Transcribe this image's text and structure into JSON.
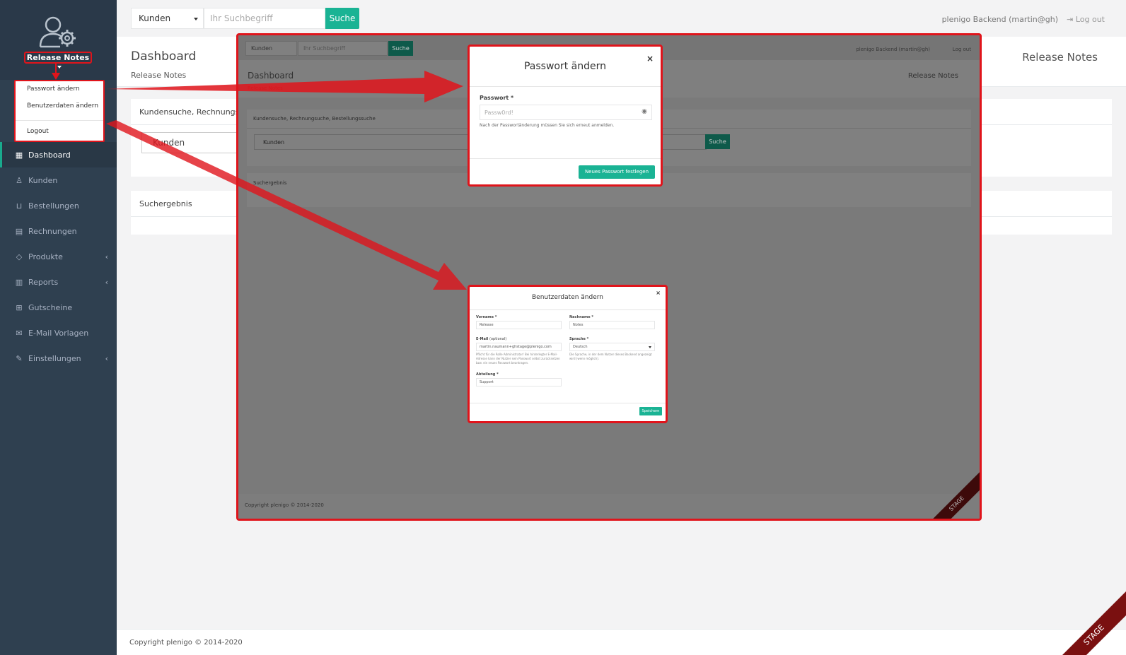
{
  "sidebar": {
    "profile_name": "Release Notes",
    "dropdown": [
      "Passwort ändern",
      "Benutzerdaten ändern",
      "Logout"
    ],
    "items": [
      {
        "label": "Dashboard",
        "icon": "grid-icon",
        "active": true
      },
      {
        "label": "Kunden",
        "icon": "user-icon"
      },
      {
        "label": "Bestellungen",
        "icon": "basket-icon"
      },
      {
        "label": "Rechnungen",
        "icon": "document-icon"
      },
      {
        "label": "Produkte",
        "icon": "tag-icon",
        "has_submenu": true
      },
      {
        "label": "Reports",
        "icon": "bar-chart-icon",
        "has_submenu": true
      },
      {
        "label": "Gutscheine",
        "icon": "gift-icon"
      },
      {
        "label": "E-Mail Vorlagen",
        "icon": "mail-settings-icon"
      },
      {
        "label": "Einstellungen",
        "icon": "wrench-icon",
        "has_submenu": true
      }
    ]
  },
  "topbar": {
    "select_value": "Kunden",
    "search_placeholder": "Ihr Suchbegriff",
    "search_button": "Suche",
    "user_label": "plenigo Backend (martin@gh)",
    "logout": "Log out"
  },
  "page": {
    "title": "Dashboard",
    "breadcrumb": "Release Notes",
    "right_title": "Release Notes"
  },
  "panels": {
    "search_title": "Kundensuche, Rechnungsuc",
    "search_select": "Kunden",
    "result_title": "Suchergebnis"
  },
  "footer": {
    "copyright": "Copyright plenigo © 2014-2020"
  },
  "stage_label": "STAGE",
  "shot": {
    "select_value": "Kunden",
    "search_placeholder": "Ihr Suchbegriff",
    "search_button": "Suche",
    "user_label": "plenigo Backend (martin@gh)",
    "logout": "Log out",
    "title": "Dashboard",
    "breadcrumb": "Release Notes",
    "right_title": "Release Notes",
    "panel_title": "Kundensuche, Rechnungsuche, Bestellungssuche",
    "panel_select": "Kunden",
    "panel_button": "Suche",
    "result_title": "Suchergebnis",
    "footer": "Copyright plenigo © 2014-2020",
    "stage": "STAGE"
  },
  "modal_password": {
    "title": "Passwort ändern",
    "close": "×",
    "label": "Passwort *",
    "placeholder": "Passw0rd!",
    "help": "Nach der Passwortänderung müssen Sie sich erneut anmelden.",
    "button": "Neues Passwort festlegen"
  },
  "modal_userdata": {
    "title": "Benutzerdaten ändern",
    "close": "×",
    "firstname_label": "Vorname *",
    "firstname_value": "Release",
    "lastname_label": "Nachname *",
    "lastname_value": "Notes",
    "email_label": "E-Mail",
    "email_optional": "(optional)",
    "email_value": "martin.naumann+ghstage@plenigo.com",
    "email_help": "Pflicht für die Rolle Administrator! Bei hinterlegter E-Mail-Adresse kann der Nutzer sein Passwort selbst zurücksetzen bzw. ein neues Passwort beantragen.",
    "language_label": "Sprache *",
    "language_value": "Deutsch",
    "language_help": "Die Sprache, in der dem Nutzer dieses Backend angezeigt wird (wenn möglich).",
    "department_label": "Abteilung *",
    "department_value": "Support",
    "button": "Speichern"
  },
  "colors": {
    "sidebar_bg": "#2f4050",
    "accent": "#1ab394",
    "highlight": "#e0141b"
  }
}
